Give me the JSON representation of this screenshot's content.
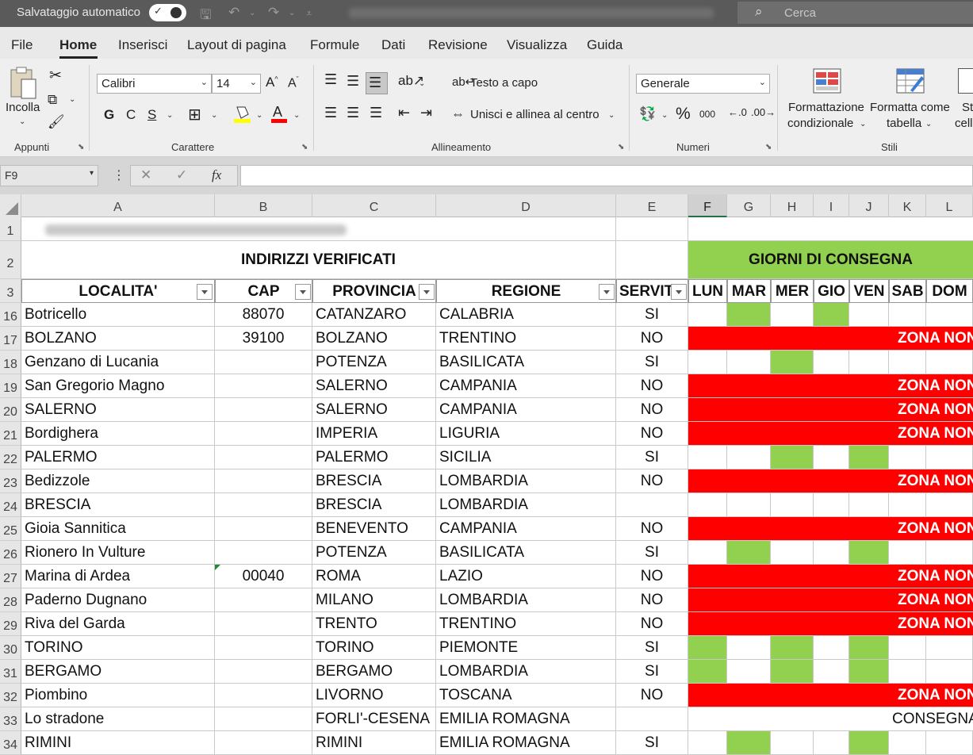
{
  "titlebar": {
    "autosave_label": "Salvataggio automatico",
    "search_placeholder": "Cerca"
  },
  "tabs": [
    "File",
    "Home",
    "Inserisci",
    "Layout di pagina",
    "Formule",
    "Dati",
    "Revisione",
    "Visualizza",
    "Guida"
  ],
  "ribbon": {
    "clipboard": {
      "paste_label": "Incolla",
      "group_label": "Appunti"
    },
    "font": {
      "font_name": "Calibri",
      "font_size": "14",
      "bold": "G",
      "italic": "C",
      "underline": "S",
      "group_label": "Carattere"
    },
    "alignment": {
      "wrap_label": "Testo a capo",
      "merge_label": "Unisci e allinea al centro",
      "group_label": "Allineamento"
    },
    "number": {
      "format": "Generale",
      "percent": "%",
      "thousands": "000",
      "group_label": "Numeri"
    },
    "styles": {
      "cond_format_l1": "Formattazione",
      "cond_format_l2": "condizionale",
      "format_table_l1": "Formatta come",
      "format_table_l2": "tabella",
      "cell_styles_l1": "Sti",
      "cell_styles_l2": "cell",
      "group_label": "Stili"
    }
  },
  "formula_bar": {
    "name_box": "F9",
    "fx": "fx",
    "value": ""
  },
  "columns": [
    "A",
    "B",
    "C",
    "D",
    "E",
    "F",
    "G",
    "H",
    "I",
    "J",
    "K",
    "L"
  ],
  "selected_column": "F",
  "sheet": {
    "title_row": {
      "row": "1"
    },
    "header_row": {
      "row": "2",
      "indirizzi": "INDIRIZZI VERIFICATI",
      "giorni": "GIORNI DI CONSEGNA"
    },
    "col_headers_row": {
      "row": "3",
      "localita": "LOCALITA'",
      "cap": "CAP",
      "provincia": "PROVINCIA",
      "regione": "REGIONE",
      "servito": "SERVIT",
      "days": [
        "LUN",
        "MAR",
        "MER",
        "GIO",
        "VEN",
        "SAB",
        "DOM"
      ]
    },
    "rows": [
      {
        "row": "16",
        "localita": "Botricello",
        "cap": "88070",
        "provincia": "CATANZARO",
        "regione": "CALABRIA",
        "servito": "SI",
        "days": [
          0,
          1,
          0,
          1,
          0,
          0,
          0
        ],
        "zona": ""
      },
      {
        "row": "17",
        "localita": "BOLZANO",
        "cap": "39100",
        "provincia": "BOLZANO",
        "regione": "TRENTINO",
        "servito": "NO",
        "days": [],
        "zona": "ZONA NON"
      },
      {
        "row": "18",
        "localita": "Genzano di Lucania",
        "cap": "",
        "provincia": "POTENZA",
        "regione": "BASILICATA",
        "servito": "SI",
        "days": [
          0,
          0,
          1,
          0,
          0,
          0,
          0
        ],
        "zona": ""
      },
      {
        "row": "19",
        "localita": "San Gregorio Magno",
        "cap": "",
        "provincia": "SALERNO",
        "regione": "CAMPANIA",
        "servito": "NO",
        "days": [],
        "zona": "ZONA NON"
      },
      {
        "row": "20",
        "localita": "SALERNO",
        "cap": "",
        "provincia": "SALERNO",
        "regione": "CAMPANIA",
        "servito": "NO",
        "days": [],
        "zona": "ZONA NON"
      },
      {
        "row": "21",
        "localita": "Bordighera",
        "cap": "",
        "provincia": "IMPERIA",
        "regione": "LIGURIA",
        "servito": "NO",
        "days": [],
        "zona": "ZONA NON"
      },
      {
        "row": "22",
        "localita": "PALERMO",
        "cap": "",
        "provincia": "PALERMO",
        "regione": "SICILIA",
        "servito": "SI",
        "days": [
          0,
          0,
          1,
          0,
          1,
          0,
          0
        ],
        "zona": ""
      },
      {
        "row": "23",
        "localita": "Bedizzole",
        "cap": "",
        "provincia": "BRESCIA",
        "regione": "LOMBARDIA",
        "servito": "NO",
        "days": [],
        "zona": "ZONA NON"
      },
      {
        "row": "24",
        "localita": "BRESCIA",
        "cap": "",
        "provincia": "BRESCIA",
        "regione": "LOMBARDIA",
        "servito": "",
        "days": [
          0,
          0,
          0,
          0,
          0,
          0,
          0
        ],
        "zona": ""
      },
      {
        "row": "25",
        "localita": "Gioia Sannitica",
        "cap": "",
        "provincia": "BENEVENTO",
        "regione": "CAMPANIA",
        "servito": "NO",
        "days": [],
        "zona": "ZONA NON"
      },
      {
        "row": "26",
        "localita": "Rionero In Vulture",
        "cap": "",
        "provincia": "POTENZA",
        "regione": "BASILICATA",
        "servito": "SI",
        "days": [
          0,
          1,
          0,
          0,
          1,
          0,
          0
        ],
        "zona": ""
      },
      {
        "row": "27",
        "localita": "Marina di Ardea",
        "cap": "00040",
        "provincia": "ROMA",
        "regione": "LAZIO",
        "servito": "NO",
        "days": [],
        "zona": "ZONA NON",
        "cap_flag": true
      },
      {
        "row": "28",
        "localita": "Paderno Dugnano",
        "cap": "",
        "provincia": "MILANO",
        "regione": "LOMBARDIA",
        "servito": "NO",
        "days": [],
        "zona": "ZONA NON"
      },
      {
        "row": "29",
        "localita": "Riva del Garda",
        "cap": "",
        "provincia": "TRENTO",
        "regione": "TRENTINO",
        "servito": "NO",
        "days": [],
        "zona": "ZONA NON"
      },
      {
        "row": "30",
        "localita": "TORINO",
        "cap": "",
        "provincia": "TORINO",
        "regione": "PIEMONTE",
        "servito": "SI",
        "days": [
          1,
          0,
          1,
          0,
          1,
          0,
          0
        ],
        "zona": ""
      },
      {
        "row": "31",
        "localita": "BERGAMO",
        "cap": "",
        "provincia": "BERGAMO",
        "regione": "LOMBARDIA",
        "servito": "SI",
        "days": [
          1,
          0,
          1,
          0,
          1,
          0,
          0
        ],
        "zona": ""
      },
      {
        "row": "32",
        "localita": "Piombino",
        "cap": "",
        "provincia": "LIVORNO",
        "regione": "TOSCANA",
        "servito": "NO",
        "days": [],
        "zona": "ZONA NON"
      },
      {
        "row": "33",
        "localita": "Lo stradone",
        "cap": "",
        "provincia": "FORLI'-CESENA",
        "regione": "EMILIA ROMAGNA",
        "servito": "",
        "days": [],
        "zona": "",
        "note": "CONSEGNA"
      },
      {
        "row": "34",
        "localita": "RIMINI",
        "cap": "",
        "provincia": "RIMINI",
        "regione": "EMILIA ROMAGNA",
        "servito": "SI",
        "days": [
          0,
          1,
          0,
          0,
          1,
          0,
          0
        ],
        "zona": ""
      }
    ]
  },
  "colors": {
    "green": "#92d050",
    "red": "#ff0000",
    "excel_green": "#217346",
    "titlebar": "#5a5a5a"
  }
}
